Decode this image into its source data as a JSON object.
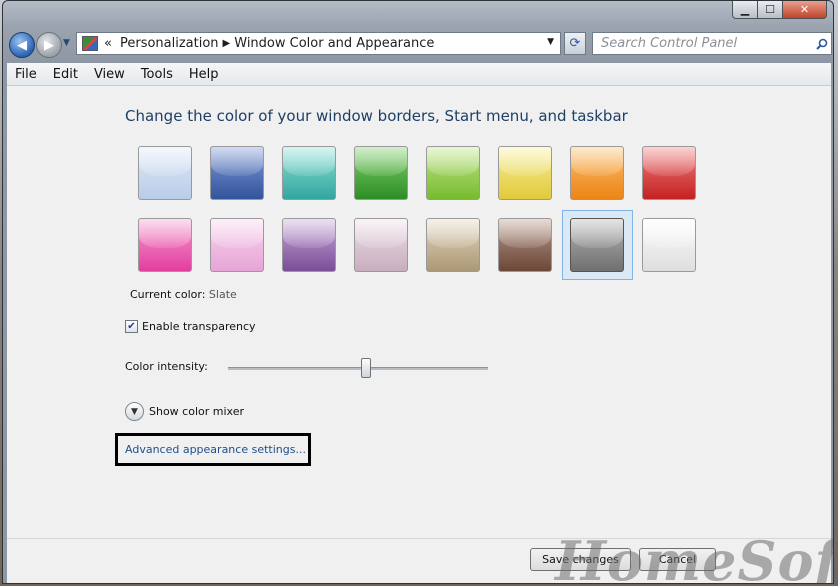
{
  "nav": {
    "crumb_prefix": "«",
    "breadcrumb": [
      "Personalization",
      "Window Color and Appearance"
    ],
    "search_placeholder": "Search Control Panel"
  },
  "menu": [
    "File",
    "Edit",
    "View",
    "Tools",
    "Help"
  ],
  "main": {
    "title": "Change the color of your window borders, Start menu, and taskbar",
    "current_color_label": "Current color:",
    "current_color_value": "Slate",
    "selected_swatch_index": 14,
    "swatches": [
      {
        "top": "#dfe9f7",
        "bottom": "#b9cde8"
      },
      {
        "top": "#7e98d6",
        "bottom": "#33549b"
      },
      {
        "top": "#8fe0d6",
        "bottom": "#32a6a0"
      },
      {
        "top": "#7fd06c",
        "bottom": "#2d8e25"
      },
      {
        "top": "#bfe58a",
        "bottom": "#77bb2e"
      },
      {
        "top": "#f7ef9a",
        "bottom": "#e2c93b"
      },
      {
        "top": "#fbc06f",
        "bottom": "#ec8415"
      },
      {
        "top": "#f07f7f",
        "bottom": "#c42121"
      },
      {
        "top": "#f79bd0",
        "bottom": "#e23e9d"
      },
      {
        "top": "#f8d4ef",
        "bottom": "#e6a5d6"
      },
      {
        "top": "#c7a6d8",
        "bottom": "#7b4d97"
      },
      {
        "top": "#eddde6",
        "bottom": "#c8aebf"
      },
      {
        "top": "#e3d6bd",
        "bottom": "#ab9876"
      },
      {
        "top": "#b89a8c",
        "bottom": "#6b4737"
      },
      {
        "top": "#b5b5b5",
        "bottom": "#6f6f6f"
      },
      {
        "top": "#fcfcfc",
        "bottom": "#dedede"
      }
    ],
    "transparency_label": "Enable transparency",
    "transparency_checked": true,
    "intensity_label": "Color intensity:",
    "intensity_fraction": 0.53,
    "mixer_label": "Show color mixer",
    "advanced_link": "Advanced appearance settings..."
  },
  "buttons": {
    "save": "Save changes",
    "cancel": "Cancel"
  },
  "watermark": "HomeSoft"
}
